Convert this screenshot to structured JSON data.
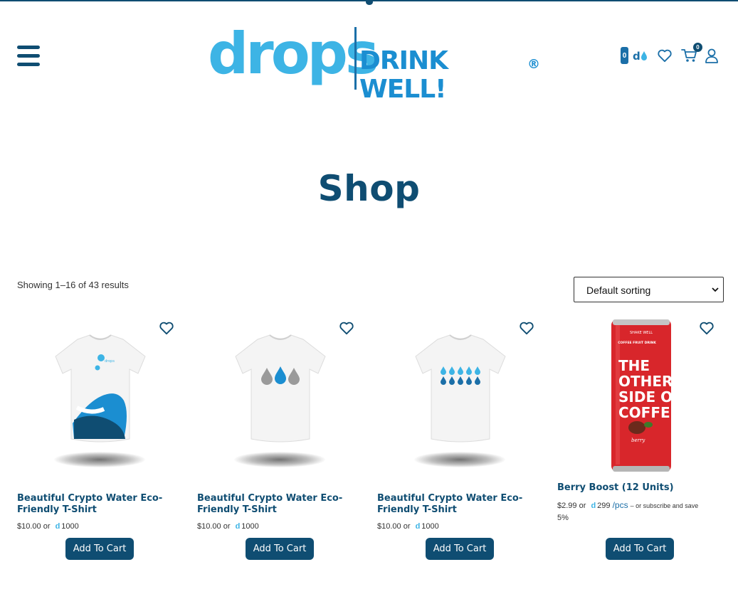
{
  "header": {
    "drops_balance": "0",
    "cart_count": "0",
    "logo": {
      "wordmark": "drops",
      "tagline": "DRINK WELL!",
      "registered": "®"
    }
  },
  "page": {
    "title": "Shop",
    "result_count": "Showing 1–16 of 43 results",
    "sort_selected": "Default sorting"
  },
  "products": [
    {
      "name": "Beautiful Crypto Water Eco-Friendly T-Shirt",
      "price_usd": "$10.00",
      "or": "or",
      "token_symbol": "d",
      "price_drops": "1000",
      "button": "Add To Cart"
    },
    {
      "name": "Beautiful Crypto Water Eco-Friendly T-Shirt",
      "price_usd": "$10.00",
      "or": "or",
      "token_symbol": "d",
      "price_drops": "1000",
      "button": "Add To Cart"
    },
    {
      "name": "Beautiful Crypto Water Eco-Friendly T-Shirt",
      "price_usd": "$10.00",
      "or": "or",
      "token_symbol": "d",
      "price_drops": "1000",
      "button": "Add To Cart"
    },
    {
      "name": "Berry Boost (12 Units)",
      "price_usd": "$2.99",
      "or": "or",
      "token_symbol": "d",
      "price_drops": "299",
      "unit": "/pcs",
      "subscribe_note": "– or subscribe and save",
      "subscribe_discount": "5%",
      "button": "Add To Cart",
      "can_text": {
        "brand": "SHAKE WELL",
        "type": "COFFEE FRUIT DRINK",
        "headline": [
          "THE",
          "OTHER",
          "SIDE OF",
          "COFFEE"
        ],
        "flavor": "berry"
      }
    }
  ],
  "colors": {
    "primary": "#0f4d72",
    "accent": "#3db4e5",
    "brand_blue": "#1b8ed1",
    "can_red": "#d8262b"
  },
  "icons": [
    "hamburger-menu-icon",
    "drops-token-icon",
    "heart-icon",
    "cart-icon",
    "user-icon"
  ]
}
